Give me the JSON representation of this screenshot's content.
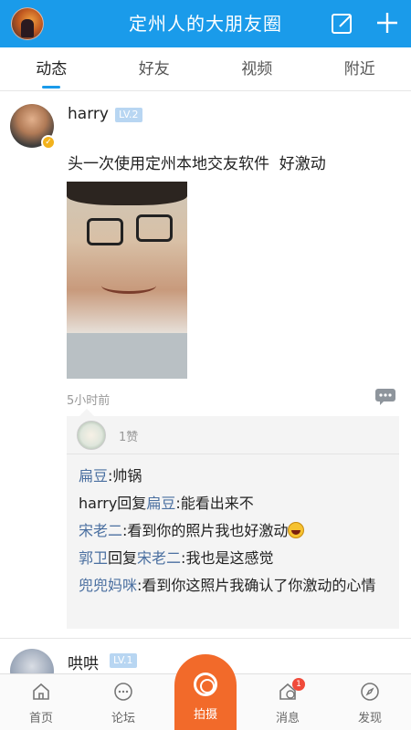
{
  "header": {
    "title": "定州人的大朋友圈",
    "icons": [
      "avatar",
      "edit-icon",
      "plus-icon"
    ]
  },
  "tabs": [
    {
      "label": "动态",
      "active": true
    },
    {
      "label": "好友",
      "active": false
    },
    {
      "label": "视频",
      "active": false
    },
    {
      "label": "附近",
      "active": false
    }
  ],
  "post": {
    "username": "harry",
    "level": "LV.2",
    "text": "头一次使用定州本地交友软件  好激动",
    "time": "5小时前",
    "likes": "1赞",
    "comments": [
      {
        "name": "扁豆",
        "text": ":帅锅"
      },
      {
        "name": "harry",
        "reply_word": "回复",
        "reply_to": "扁豆",
        "text": ":能看出来不"
      },
      {
        "name": "宋老二",
        "text": ":看到你的照片我也好激动",
        "emoji": "grinning-emoji"
      },
      {
        "name": "郭卫",
        "reply_word": "回复",
        "reply_to": "宋老二",
        "text": ":我也是这感觉"
      },
      {
        "name": "兜兜妈咪",
        "text": ":看到你这照片我确认了你激动的心情"
      }
    ]
  },
  "post2": {
    "username": "哄哄",
    "level": "LV.1"
  },
  "bottom_nav": {
    "home": "首页",
    "forum": "论坛",
    "capture": "拍摄",
    "messages": "消息",
    "messages_badge": "1",
    "discover": "发现"
  },
  "colors": {
    "brand": "#1a9bea",
    "capture": "#f26a2a",
    "link": "#4a6fa0",
    "badge": "#f04a3a"
  }
}
